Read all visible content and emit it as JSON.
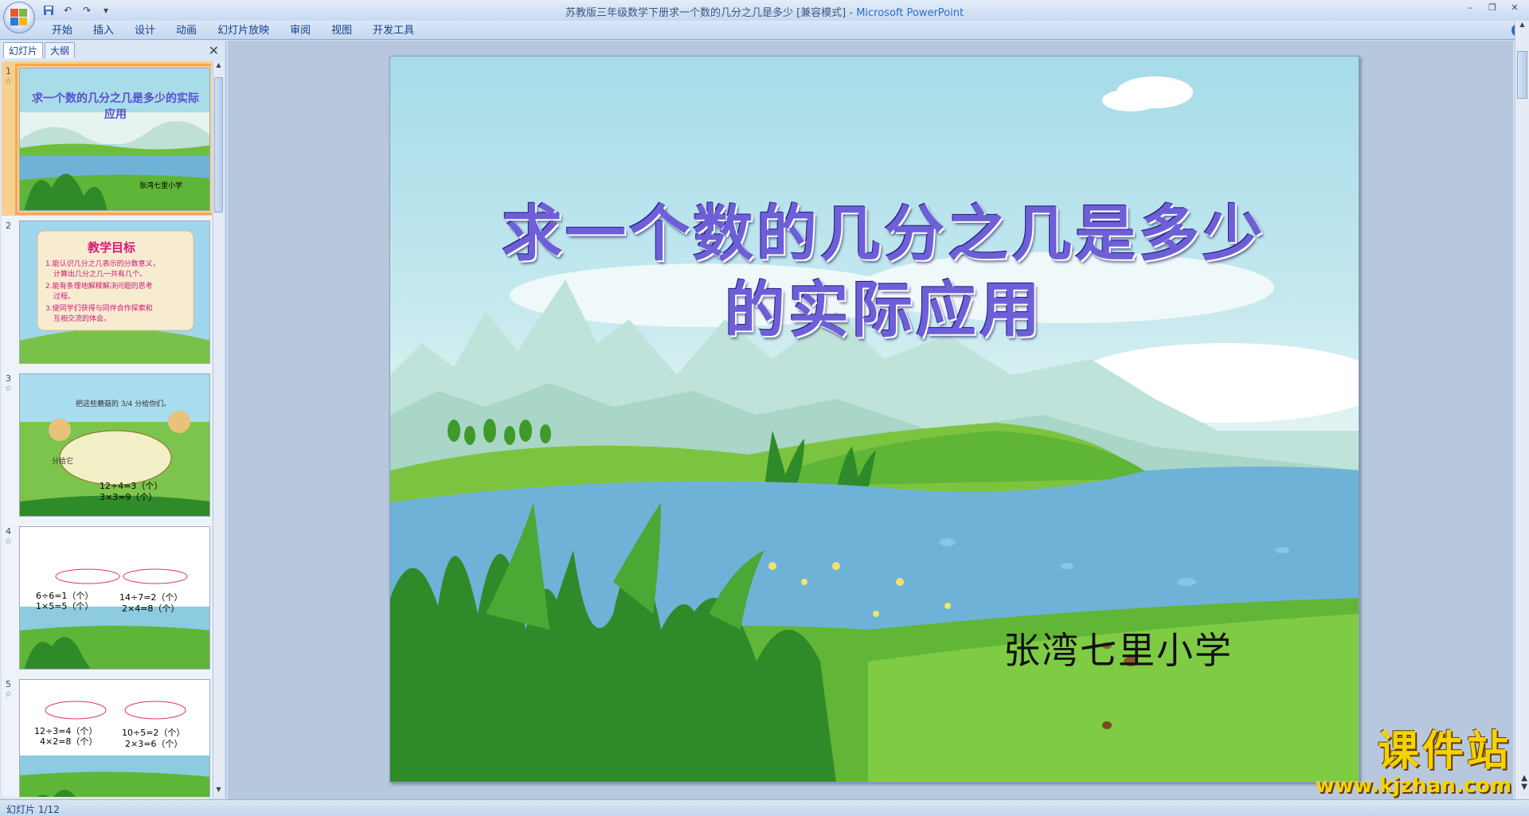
{
  "window": {
    "title": "苏教版三年级数学下册求一个数的几分之几是多少 [兼容模式]",
    "separator": " - ",
    "app_name": "Microsoft PowerPoint"
  },
  "ribbon": {
    "tabs": [
      "开始",
      "插入",
      "设计",
      "动画",
      "幻灯片放映",
      "审阅",
      "视图",
      "开发工具"
    ]
  },
  "left_pane": {
    "tabs": [
      "幻灯片",
      "大纲"
    ]
  },
  "thumbnails": [
    {
      "number": "1",
      "title": "求一个数的几分之几是多少的实际应用",
      "caption": "张湾七里小学"
    },
    {
      "number": "2",
      "heading": "教学目标",
      "lines": [
        "1.能认识几分之几表示的分数意义，",
        "计算出几分之几一共有几个。",
        "2.能有条理地解释解决问题的思考",
        "过程。",
        "3.使同学们获得与同伴合作探索和",
        "互相交流的体会。"
      ]
    },
    {
      "number": "3",
      "prompt": "把这些蘑菇的 3/4 分给你们。",
      "side": "分给它",
      "calc": [
        "12÷4=3（个）",
        "3×3=9（个）"
      ]
    },
    {
      "number": "4",
      "calc_left": [
        "6÷6=1（个）",
        "1×5=5（个）"
      ],
      "calc_right": [
        "14÷7=2（个）",
        "2×4=8（个）"
      ]
    },
    {
      "number": "5",
      "calc_left": [
        "12÷3=4（个）",
        "4×2=8（个）"
      ],
      "calc_right": [
        "10÷5=2（个）",
        "2×3=6（个）"
      ]
    }
  ],
  "slide": {
    "title_line1": "求一个数的几分之几是多少",
    "title_line2": "的实际应用",
    "subtitle": "张湾七里小学"
  },
  "watermark": {
    "brand": "课件站",
    "url": "www.kjzhan.com"
  },
  "status": {
    "slide_counter": "幻灯片 1/12"
  },
  "colors": {
    "title_text": "#6e5fd8",
    "ribbon_bg": "#dbe7f7",
    "selected_thumb": "#f7a84a",
    "watermark": "#f3d400"
  }
}
